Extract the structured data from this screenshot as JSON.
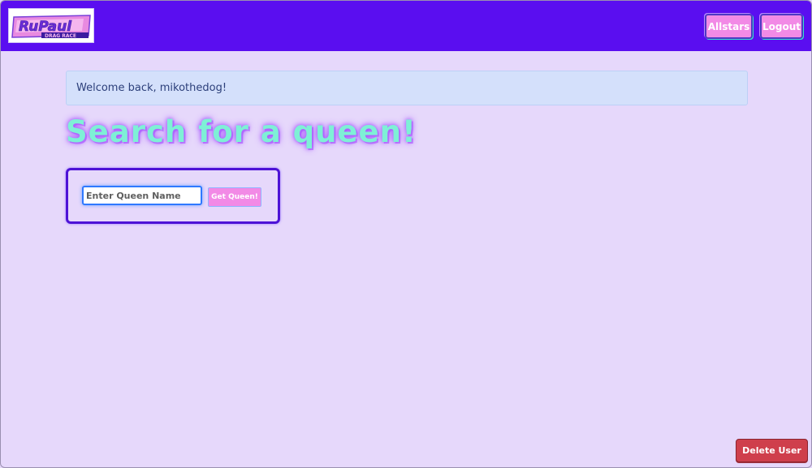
{
  "navbar": {
    "logo_text": "RuPaul's Drag Race",
    "allstars_label": "Allstars",
    "logout_label": "Logout",
    "background_color": "#5a0ef0"
  },
  "alert": {
    "message": "Welcome back, mikothedog!"
  },
  "main": {
    "heading": "Search for a queen!",
    "search": {
      "placeholder": "Enter Queen Name",
      "value": "",
      "button_label": "Get Queen!"
    }
  },
  "footer": {
    "delete_label": "Delete User"
  },
  "colors": {
    "page_background": "#e6d8fb",
    "button_pink": "#f28ae6",
    "heading_mint": "#7ef0d6",
    "delete_red": "#cf3f4c"
  }
}
